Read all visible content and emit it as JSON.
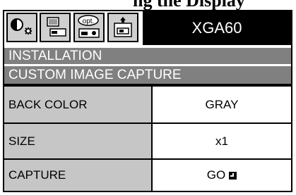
{
  "caption": "ng the Display",
  "model": "XGA60",
  "tabs": [
    {
      "name": "picture-icon"
    },
    {
      "name": "image-icon"
    },
    {
      "name": "option-icon",
      "label": "opt."
    },
    {
      "name": "installation-icon"
    }
  ],
  "menu": {
    "section": "INSTALLATION",
    "title": "CUSTOM IMAGE CAPTURE",
    "rows": [
      {
        "label": "BACK COLOR",
        "value": "GRAY"
      },
      {
        "label": "SIZE",
        "value": "x1"
      },
      {
        "label": "CAPTURE",
        "value": "GO",
        "icon": "enter-icon"
      }
    ]
  },
  "colors": {
    "header": "#808080",
    "label_bg": "#c6c6c6",
    "model_bg": "#000000"
  }
}
